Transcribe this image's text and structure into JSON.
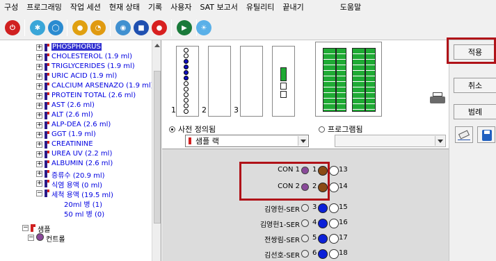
{
  "menu": {
    "items": [
      "구성",
      "프로그래밍",
      "작업 세션",
      "현재 상태",
      "기록",
      "사용자",
      "SAT 보고서",
      "유틸리티",
      "끝내기"
    ],
    "help": "도움말"
  },
  "toolbar": {
    "icons": [
      "power-icon",
      "settings-icon",
      "globe-icon",
      "tube-icon",
      "clock-icon",
      "eye-icon",
      "reagent-icon",
      "alert-icon",
      "start-icon",
      "sun-icon"
    ]
  },
  "tree": {
    "items": [
      {
        "label": "PHOSPHORUS",
        "selected": true
      },
      {
        "label": "CHOLESTEROL (1.9 ml)"
      },
      {
        "label": "TRIGLYCERIDES (1.9 ml)"
      },
      {
        "label": "URIC ACID (1.9 ml)"
      },
      {
        "label": "CALCIUM ARSENAZO (1.9 ml)"
      },
      {
        "label": "PROTEIN TOTAL (2.6 ml)"
      },
      {
        "label": "AST (2.6 ml)"
      },
      {
        "label": "ALT (2.6 ml)"
      },
      {
        "label": "ALP-DEA (2.6 ml)"
      },
      {
        "label": "GGT (1.9 ml)"
      },
      {
        "label": "CREATININE"
      },
      {
        "label": "UREA UV (2.2 ml)"
      },
      {
        "label": "ALBUMIN (2.6 ml)"
      },
      {
        "label": "증류수 (20.9 ml)"
      },
      {
        "label": "식염 용액 (0 ml)"
      },
      {
        "label": "세척 용액 (19.5 ml)"
      }
    ],
    "sub_items": [
      "20ml 병 (1)",
      "50 ml 병 (0)"
    ],
    "samples_label": "샘플",
    "controls_label": "컨트롤"
  },
  "racks": {
    "numbers": [
      "1",
      "2",
      "3"
    ]
  },
  "options": {
    "predefined_label": "사전 정의됨",
    "programmed_label": "프로그램됨",
    "rack_select_value": "샘플 랙"
  },
  "slots": [
    {
      "name": "CON 1",
      "pos": "1",
      "color": "brown",
      "right": "13",
      "face": "purple"
    },
    {
      "name": "CON 2",
      "pos": "2",
      "color": "brown",
      "right": "14",
      "face": "purple"
    },
    {
      "name": "김영헌-SER",
      "pos": "3",
      "color": "blue",
      "right": "15",
      "face": "smile"
    },
    {
      "name": "김영헌1-SER",
      "pos": "4",
      "color": "blue",
      "right": "16",
      "face": "smile"
    },
    {
      "name": "전쌍림-SER",
      "pos": "5",
      "color": "blue",
      "right": "17",
      "face": "smile"
    },
    {
      "name": "김선호-SER",
      "pos": "6",
      "color": "blue",
      "right": "18",
      "face": "smile"
    }
  ],
  "buttons": {
    "apply": "적용",
    "cancel": "취소",
    "legend": "범례"
  },
  "colors": {
    "highlight": "#b01218",
    "tube_blue": "#0b20d8",
    "tube_brown": "#8a4a14",
    "tree_link": "#0000e0",
    "rack_green": "#1faa34"
  }
}
